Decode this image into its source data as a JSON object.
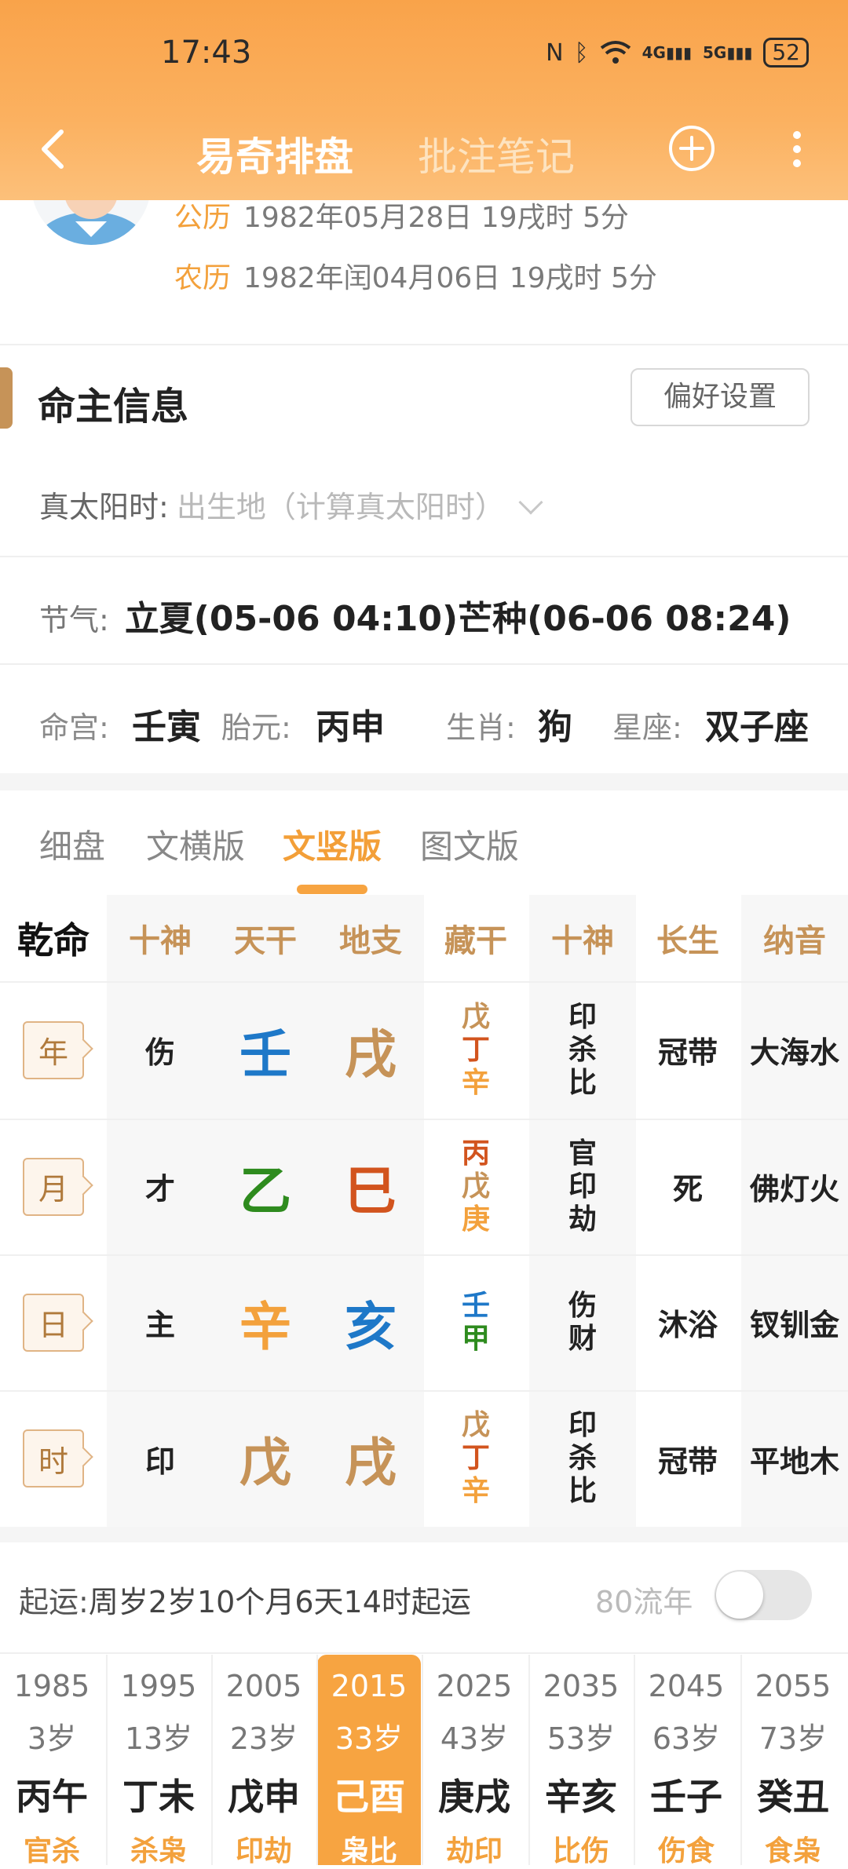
{
  "status": {
    "time": "17:43",
    "battery": "52",
    "net1": "4G",
    "net2": "5G"
  },
  "nav": {
    "title": "易奇排盘",
    "subtitle": "批注笔记"
  },
  "profile": {
    "solar_label": "公历",
    "solar_value": "1982年05月28日 19戌时 5分",
    "lunar_label": "农历",
    "lunar_value": "1982年闰04月06日 19戌时 5分"
  },
  "info": {
    "title": "命主信息",
    "pref_button": "偏好设置",
    "solar_time_label": "真太阳时:",
    "solar_time_placeholder": "出生地（计算真太阳时）",
    "jieqi_label": "节气:",
    "jieqi_value": "立夏(05-06 04:10)芒种(06-06 08:24)",
    "minggong_label": "命宫:",
    "minggong_value": "壬寅",
    "taiyuan_label": "胎元:",
    "taiyuan_value": "丙申",
    "shengxiao_label": "生肖:",
    "shengxiao_value": "狗",
    "xingzuo_label": "星座:",
    "xingzuo_value": "双子座"
  },
  "tabs": [
    "细盘",
    "文横版",
    "文竖版",
    "图文版"
  ],
  "active_tab": "文竖版",
  "table": {
    "headers": [
      "乾命",
      "十神",
      "天干",
      "地支",
      "藏干",
      "十神",
      "长生",
      "纳音"
    ],
    "rows": [
      {
        "pillar": "年",
        "shishen": "伤",
        "tiangan": "壬",
        "dizhi": "戌",
        "canggan": [
          "戊",
          "丁",
          "辛"
        ],
        "shishen2": [
          "印",
          "杀",
          "比"
        ],
        "changsheng": "冠带",
        "nayin": "大海水"
      },
      {
        "pillar": "月",
        "shishen": "才",
        "tiangan": "乙",
        "dizhi": "巳",
        "canggan": [
          "丙",
          "戊",
          "庚"
        ],
        "shishen2": [
          "官",
          "印",
          "劫"
        ],
        "changsheng": "死",
        "nayin": "佛灯火"
      },
      {
        "pillar": "日",
        "shishen": "主",
        "tiangan": "辛",
        "dizhi": "亥",
        "canggan": [
          "壬",
          "甲"
        ],
        "shishen2": [
          "伤",
          "财"
        ],
        "changsheng": "沐浴",
        "nayin": "钗钏金"
      },
      {
        "pillar": "时",
        "shishen": "印",
        "tiangan": "戊",
        "dizhi": "戌",
        "canggan": [
          "戊",
          "丁",
          "辛"
        ],
        "shishen2": [
          "印",
          "杀",
          "比"
        ],
        "changsheng": "冠带",
        "nayin": "平地木"
      }
    ],
    "colors": {
      "earth": "#c69358",
      "water": "#1e78c8",
      "wood": "#2e8b1e",
      "fire": "#d2541e",
      "metal": "#f3a13c"
    }
  },
  "luck": {
    "qiyun_label": "起运:",
    "qiyun_value": "周岁2岁10个月6天14时起运",
    "liunian_label": "80流年",
    "liunian_on": false,
    "columns": [
      {
        "year": "1985",
        "age": "3岁",
        "ganzhi": "丙午",
        "shishen": "官杀"
      },
      {
        "year": "1995",
        "age": "13岁",
        "ganzhi": "丁未",
        "shishen": "杀枭"
      },
      {
        "year": "2005",
        "age": "23岁",
        "ganzhi": "戊申",
        "shishen": "印劫"
      },
      {
        "year": "2015",
        "age": "33岁",
        "ganzhi": "己酉",
        "shishen": "枭比"
      },
      {
        "year": "2025",
        "age": "43岁",
        "ganzhi": "庚戌",
        "shishen": "劫印"
      },
      {
        "year": "2035",
        "age": "53岁",
        "ganzhi": "辛亥",
        "shishen": "比伤"
      },
      {
        "year": "2045",
        "age": "63岁",
        "ganzhi": "壬子",
        "shishen": "伤食"
      },
      {
        "year": "2055",
        "age": "73岁",
        "ganzhi": "癸丑",
        "shishen": "食枭"
      }
    ],
    "active_index": 3
  }
}
